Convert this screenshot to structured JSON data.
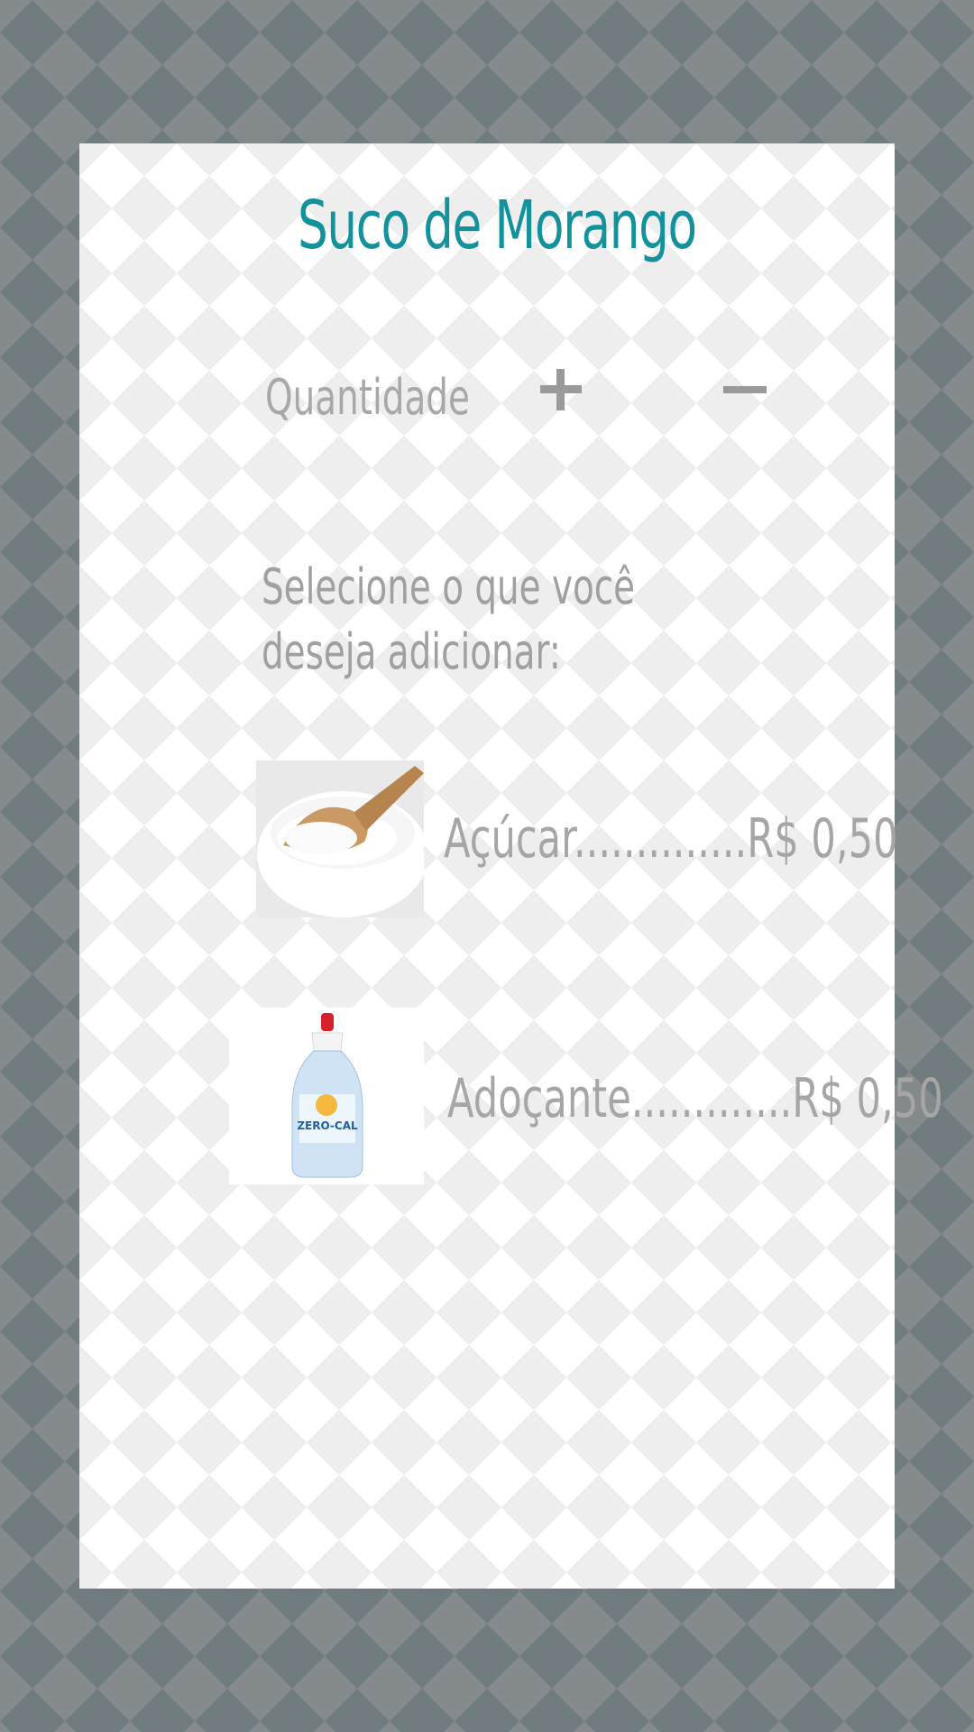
{
  "page": {
    "title": "Suco de Morango"
  },
  "quantity": {
    "label": "Quantidade",
    "increase_symbol": "+",
    "decrease_symbol": "−"
  },
  "addons": {
    "prompt": "Selecione o que você deseja adicionar:",
    "items": [
      {
        "image": "sugar-bowl-image",
        "label": "Açúcar..............R$ 0,50"
      },
      {
        "image": "sweetener-bottle-image",
        "label": "Adoçante.............R$ 0,50",
        "brand_text": "ZERO-CAL"
      }
    ]
  },
  "colors": {
    "title": "#14929b",
    "text_muted": "#a6a6a6",
    "background": "#6f7b7e",
    "card": "#ffffff"
  }
}
